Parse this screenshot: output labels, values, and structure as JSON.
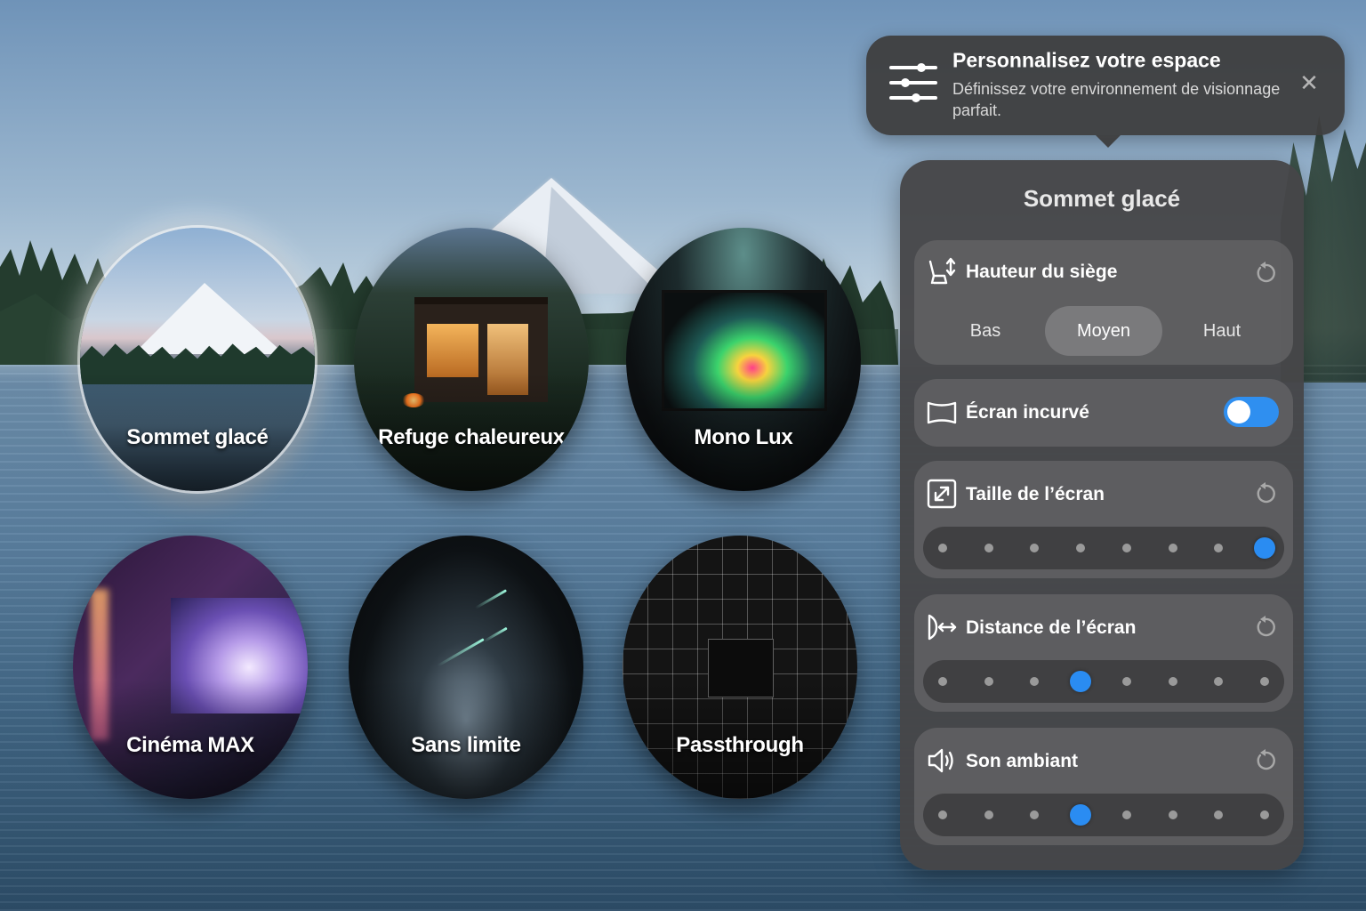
{
  "environments": [
    {
      "label": "Sommet glacé",
      "selected": true
    },
    {
      "label": "Refuge chaleureux",
      "selected": false
    },
    {
      "label": "Mono Lux",
      "selected": false
    },
    {
      "label": "Cinéma MAX",
      "selected": false
    },
    {
      "label": "Sans limite",
      "selected": false
    },
    {
      "label": "Passthrough",
      "selected": false
    }
  ],
  "tooltip": {
    "title": "Personnalisez votre espace",
    "subtitle": "Définissez votre environnement de visionnage parfait.",
    "icon": "sliders-icon",
    "close_icon": "close-icon"
  },
  "panel": {
    "title": "Sommet glacé",
    "seat_height": {
      "label": "Hauteur du siège",
      "icon": "seat-height-icon",
      "options": [
        "Bas",
        "Moyen",
        "Haut"
      ],
      "selected": "Moyen"
    },
    "curved_screen": {
      "label": "Écran incurvé",
      "icon": "curved-screen-icon",
      "enabled": true
    },
    "screen_size": {
      "label": "Taille de l’écran",
      "icon": "resize-icon",
      "steps": 8,
      "value_index": 7
    },
    "screen_distance": {
      "label": "Distance de l’écran",
      "icon": "distance-icon",
      "steps": 8,
      "value_index": 3
    },
    "ambient_sound": {
      "label": "Son ambiant",
      "icon": "speaker-icon",
      "steps": 8,
      "value_index": 3
    }
  },
  "colors": {
    "accent": "#2a8cf2",
    "panel_bg": "#464648",
    "card_bg": "#5f5f61"
  }
}
